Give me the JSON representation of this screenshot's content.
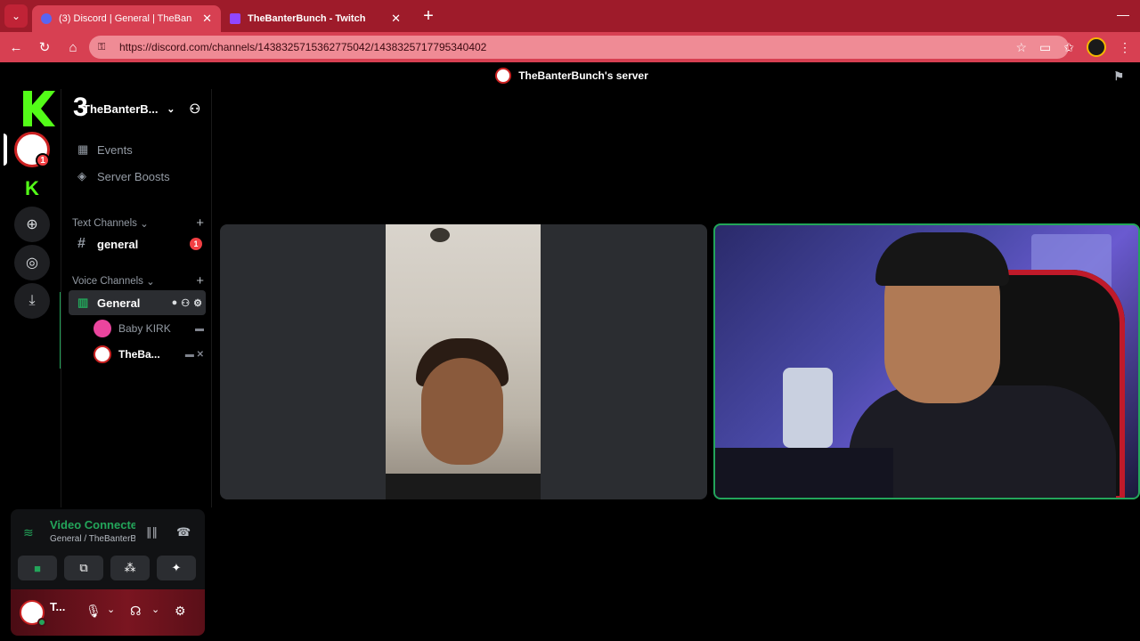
{
  "browser": {
    "tabs": [
      {
        "label": "(3) Discord | General | TheBan",
        "active": true
      },
      {
        "label": "TheBanterBunch - Twitch",
        "active": false
      }
    ],
    "url": "https://discord.com/channels/1438325715362775042/1438325717795340402"
  },
  "server": {
    "title": "TheBanterBunch's server",
    "short_name": "TheBanterB...",
    "guild_badge": "1"
  },
  "channels": {
    "events": "Events",
    "boosts": "Server Boosts",
    "text_category": "Text Channels",
    "text_channel": "general",
    "text_badge": "1",
    "voice_category": "Voice Channels",
    "voice_channel": "General",
    "voice_users": [
      "Baby KIRK",
      "TheBa..."
    ]
  },
  "voice_panel": {
    "status": "Video Connected",
    "location": "General / TheBanterBunch's server"
  },
  "user_panel": {
    "name": "T..."
  },
  "overlay_logo": "K3",
  "colors": {
    "accent_green": "#23a55a",
    "browser_red": "#d74052",
    "badge_red": "#f23f43"
  }
}
